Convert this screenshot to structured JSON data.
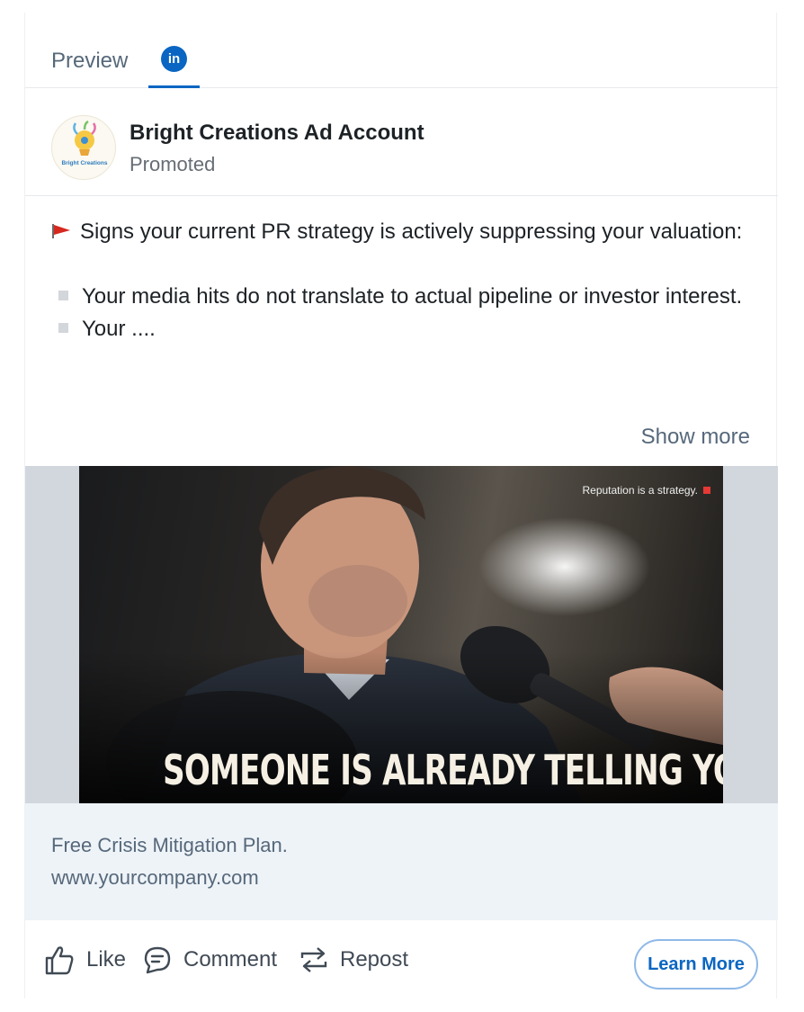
{
  "tabs": {
    "preview_label": "Preview",
    "linkedin_label": "in"
  },
  "post": {
    "account_name": "Bright Creations Ad Account",
    "account_logo_text": "Bright Creations",
    "promoted_label": "Promoted",
    "line1": "Signs your current PR strategy is actively suppressing your valuation:",
    "bullet1": "Your media hits do not translate to actual pipeline or investor interest.",
    "bullet2": "Your ....",
    "show_more": "Show more"
  },
  "media": {
    "tagline": "Reputation is a strategy.",
    "headline": "SOMEONE IS ALREADY TELLING YOUR STORY."
  },
  "link_preview": {
    "title": "Free Crisis Mitigation Plan.",
    "url": "www.yourcompany.com"
  },
  "actions": {
    "like": "Like",
    "comment": "Comment",
    "repost": "Repost",
    "cta": "Learn More"
  },
  "colors": {
    "brand_blue": "#0a66c2",
    "flag_red": "#d6281f",
    "link_box_bg": "#eef3f8"
  },
  "icons": [
    "linkedin-icon",
    "flag-icon",
    "bullet-icon",
    "like-icon",
    "comment-icon",
    "repost-icon"
  ]
}
